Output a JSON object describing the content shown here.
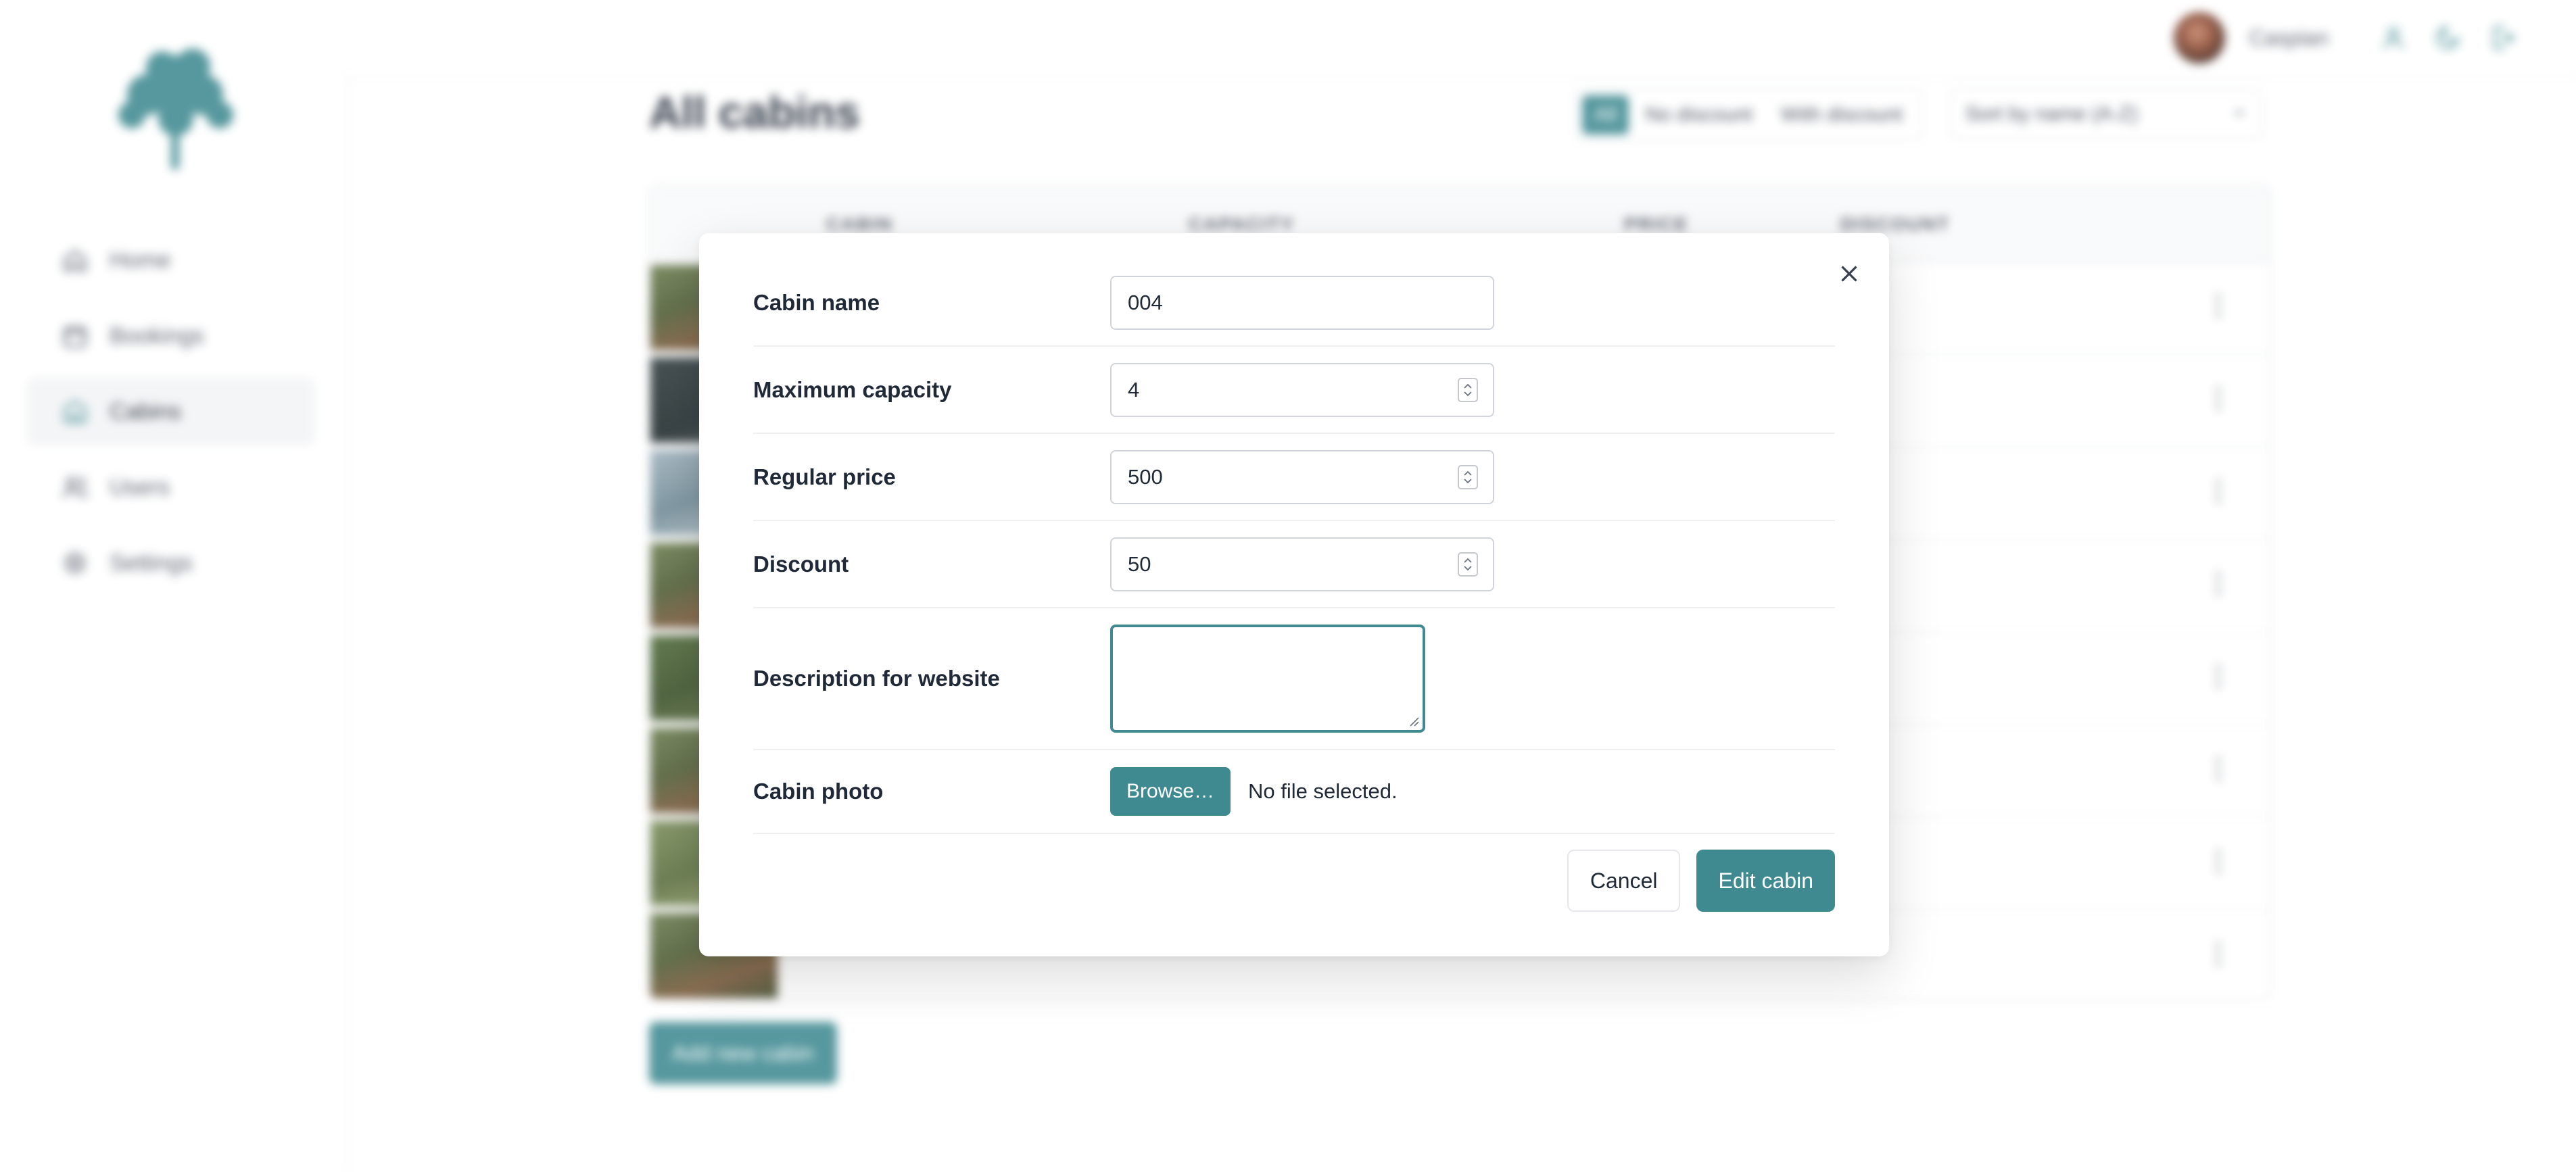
{
  "header": {
    "user_name": "Caspian",
    "icons": [
      "user-icon",
      "moon-icon",
      "logout-icon"
    ]
  },
  "sidebar": {
    "items": [
      {
        "label": "Home",
        "icon": "home-icon"
      },
      {
        "label": "Bookings",
        "icon": "calendar-icon"
      },
      {
        "label": "Cabins",
        "icon": "cabin-icon",
        "active": true
      },
      {
        "label": "Users",
        "icon": "users-icon"
      },
      {
        "label": "Settings",
        "icon": "settings-icon"
      }
    ]
  },
  "page": {
    "title": "All cabins",
    "filters": [
      "All",
      "No discount",
      "With discount"
    ],
    "active_filter": "All",
    "sort_label": "Sort by name (A-Z)",
    "add_button": "Add new cabin"
  },
  "table": {
    "headers": [
      "CABIN",
      "CAPACITY",
      "PRICE",
      "DISCOUNT"
    ]
  },
  "modal": {
    "fields": {
      "name_label": "Cabin name",
      "name_value": "004",
      "capacity_label": "Maximum capacity",
      "capacity_value": "4",
      "price_label": "Regular price",
      "price_value": "500",
      "discount_label": "Discount",
      "discount_value": "50",
      "description_label": "Description for website",
      "description_value": "",
      "photo_label": "Cabin photo",
      "browse_label": "Browse…",
      "file_status": "No file selected."
    },
    "cancel_label": "Cancel",
    "submit_label": "Edit cabin"
  },
  "colors": {
    "brand": "#3f8a91",
    "discount_green": "#15803d"
  }
}
